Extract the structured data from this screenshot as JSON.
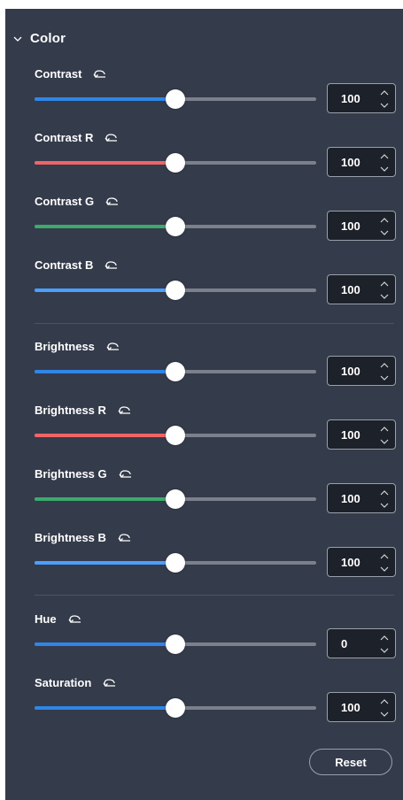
{
  "section": {
    "title": "Color",
    "expanded": true
  },
  "colors": {
    "blue": "#2f86e8",
    "red": "#f06468",
    "green": "#3daa6e",
    "lightblue": "#4aa0ff",
    "panel": "#343b4a"
  },
  "controls": [
    {
      "label": "Contrast",
      "value": "100",
      "fraction": 0.5,
      "color": "#2f86e8"
    },
    {
      "label": "Contrast R",
      "value": "100",
      "fraction": 0.5,
      "color": "#f06468"
    },
    {
      "label": "Contrast G",
      "value": "100",
      "fraction": 0.5,
      "color": "#3daa6e"
    },
    {
      "label": "Contrast B",
      "value": "100",
      "fraction": 0.5,
      "color": "#4aa0ff"
    },
    {
      "label": "Brightness",
      "value": "100",
      "fraction": 0.5,
      "color": "#2f86e8"
    },
    {
      "label": "Brightness R",
      "value": "100",
      "fraction": 0.5,
      "color": "#f06468"
    },
    {
      "label": "Brightness G",
      "value": "100",
      "fraction": 0.5,
      "color": "#3daa6e"
    },
    {
      "label": "Brightness B",
      "value": "100",
      "fraction": 0.5,
      "color": "#4aa0ff"
    },
    {
      "label": "Hue",
      "value": "0",
      "fraction": 0.5,
      "color": "#2f86e8"
    },
    {
      "label": "Saturation",
      "value": "100",
      "fraction": 0.5,
      "color": "#2f86e8"
    }
  ],
  "reset_label": "Reset",
  "icons": {
    "section_toggle": "chevron-down-icon",
    "control_reset": "undo-icon"
  }
}
